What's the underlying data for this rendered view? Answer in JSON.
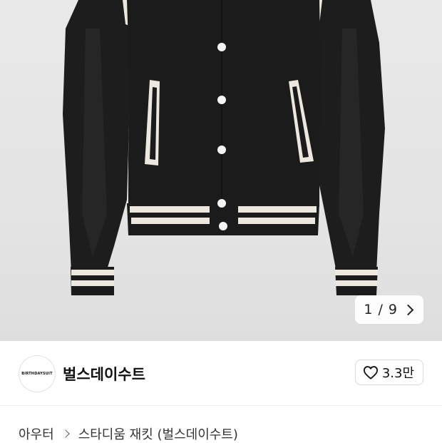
{
  "gallery": {
    "current": "1",
    "separator": "/",
    "total": "9",
    "next_icon": "chevron-right-icon"
  },
  "brand": {
    "logo_text": "BIRTHDAYSUIT",
    "name": "벌스데이수트",
    "likes": "3.3만",
    "like_icon": "heart-icon"
  },
  "breadcrumb": {
    "category": "아우터",
    "separator_icon": "chevron-right-icon",
    "product": "스타디움 재킷 (벌스데이수트)"
  },
  "colors": {
    "jacket_body": "#1b1b1b",
    "jacket_trim": "#ece8df",
    "background": "#e6e6e6"
  }
}
